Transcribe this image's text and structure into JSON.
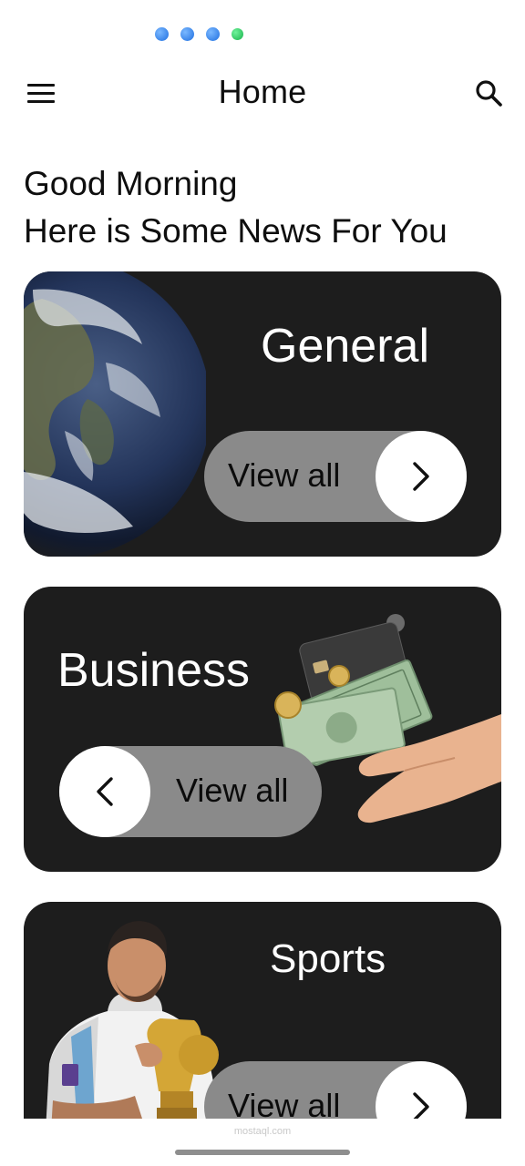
{
  "header": {
    "title": "Home",
    "menu_icon": "hamburger-menu-icon",
    "search_icon": "search-icon"
  },
  "greeting": {
    "line1": "Good Morning",
    "line2": "Here is Some News For You"
  },
  "categories": [
    {
      "title": "General",
      "button_label": "View all",
      "arrow": "chevron-right-icon",
      "image": "earth-image"
    },
    {
      "title": "Business",
      "button_label": "View all",
      "arrow": "chevron-left-icon",
      "image": "money-hand-image"
    },
    {
      "title": "Sports",
      "button_label": "View all",
      "arrow": "chevron-right-icon",
      "image": "football-player-trophy-image"
    }
  ],
  "watermark": "mostaql.com",
  "colors": {
    "card_background": "#1d1d1d",
    "pill_background": "#8a8a8a",
    "card_title": "#ffffff",
    "page_background": "#ffffff"
  }
}
